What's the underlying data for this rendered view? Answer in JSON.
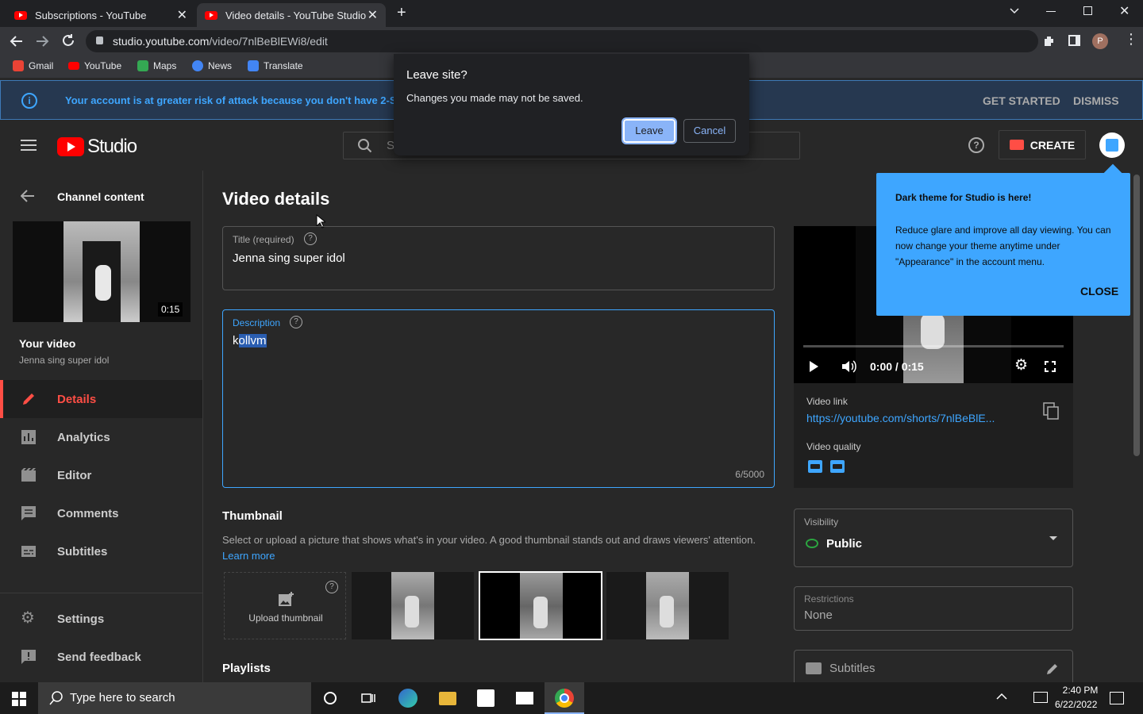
{
  "browser": {
    "tabs": [
      {
        "title": "Subscriptions - YouTube",
        "active": false
      },
      {
        "title": "Video details - YouTube Studio",
        "active": true
      }
    ],
    "url_host": "studio.youtube.com",
    "url_path": "/video/7nlBeBlEWi8/edit",
    "bookmarks": [
      "Gmail",
      "YouTube",
      "Maps",
      "News",
      "Translate"
    ],
    "profile_initial": "P"
  },
  "banner": {
    "text": "Your account is at greater risk of attack because you don't have 2-Step V",
    "get_started": "GET STARTED",
    "dismiss": "DISMISS"
  },
  "header": {
    "logo_text": "Studio",
    "search_placeholder": "S",
    "create_label": "CREATE"
  },
  "dialog": {
    "title": "Leave site?",
    "message": "Changes you made may not be saved.",
    "leave_label": "Leave",
    "cancel_label": "Cancel"
  },
  "sidebar": {
    "back_label": "Channel content",
    "duration": "0:15",
    "your_video_label": "Your video",
    "video_title": "Jenna sing super idol",
    "items": [
      {
        "label": "Details",
        "icon": "pencil-icon",
        "active": true
      },
      {
        "label": "Analytics",
        "icon": "analytics-icon",
        "active": false
      },
      {
        "label": "Editor",
        "icon": "editor-icon",
        "active": false
      },
      {
        "label": "Comments",
        "icon": "comments-icon",
        "active": false
      },
      {
        "label": "Subtitles",
        "icon": "subtitles-icon",
        "active": false
      }
    ],
    "settings_label": "Settings",
    "feedback_label": "Send feedback"
  },
  "main": {
    "heading": "Video details",
    "title_label": "Title (required)",
    "title_value": "Jenna sing super idol",
    "description_label": "Description",
    "description_first_char": "k",
    "description_selected": "ollvm",
    "description_count": "6/5000",
    "thumbnail_heading": "Thumbnail",
    "thumbnail_desc": "Select or upload a picture that shows what's in your video. A good thumbnail stands out and draws viewers' attention.",
    "learn_more": "Learn more",
    "upload_thumbnail": "Upload thumbnail",
    "playlists_heading": "Playlists"
  },
  "preview": {
    "time": "0:00 / 0:15",
    "video_link_label": "Video link",
    "video_link": "https://youtube.com/shorts/7nlBeBlE...",
    "quality_label": "Video quality",
    "quality_badges": [
      "SD",
      "HD"
    ]
  },
  "visibility": {
    "label": "Visibility",
    "value": "Public"
  },
  "restrictions": {
    "label": "Restrictions",
    "value": "None"
  },
  "subtitles_field": {
    "label": "Subtitles"
  },
  "tooltip": {
    "title": "Dark theme for Studio is here!",
    "body": "Reduce glare and improve all day viewing. You can now change your theme anytime under \"Appearance\" in the account menu.",
    "close": "CLOSE"
  },
  "taskbar": {
    "search_placeholder": "Type here to search",
    "time": "2:40 PM",
    "date": "6/22/2022"
  },
  "colors": {
    "accent_blue": "#3ea6ff",
    "active_red": "#ff4e45",
    "youtube_red": "#ff0000"
  }
}
